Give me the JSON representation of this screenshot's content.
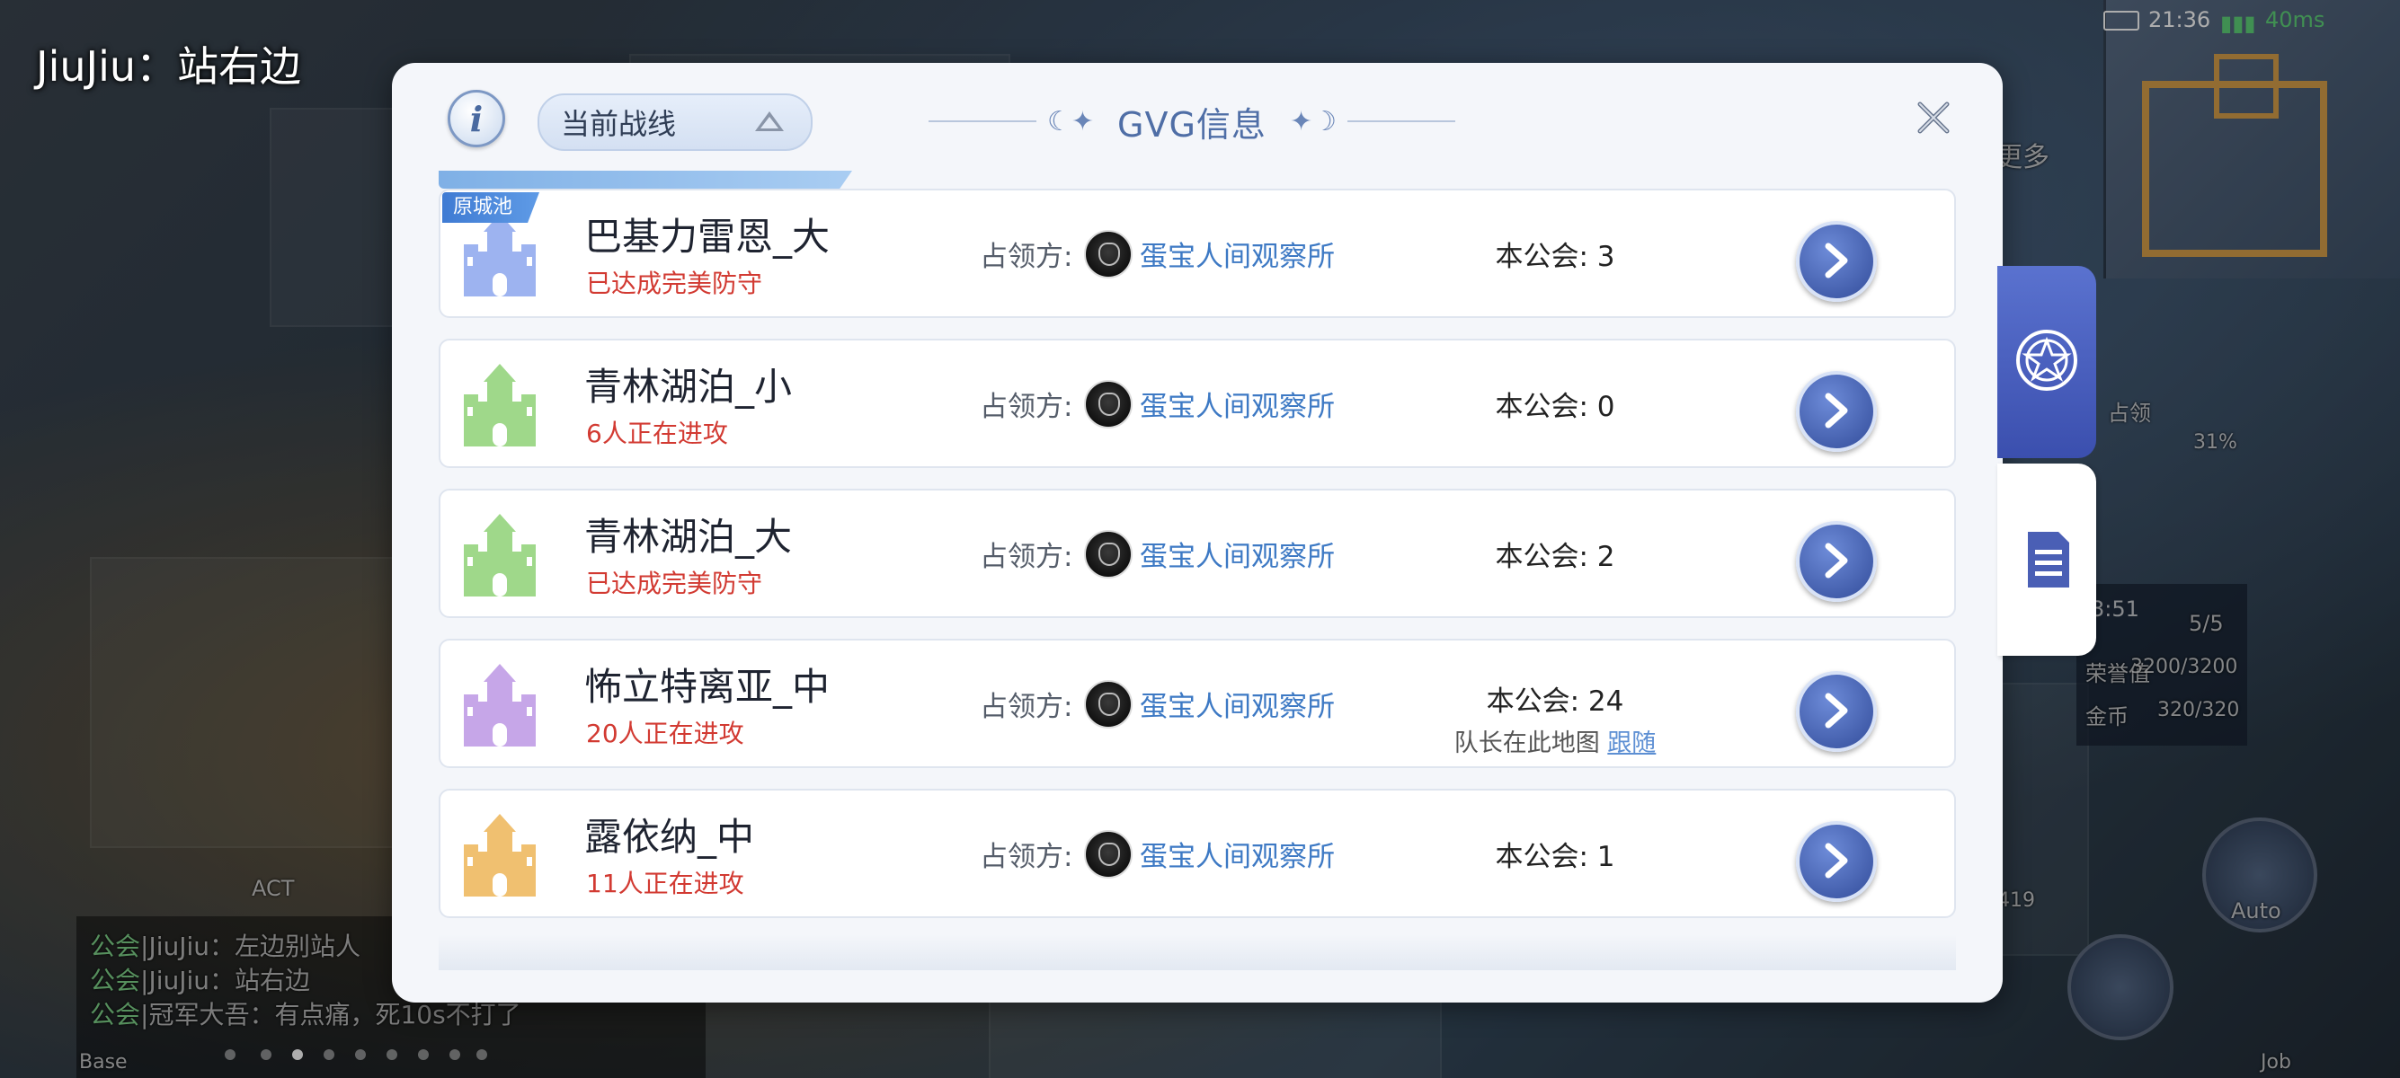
{
  "hud": {
    "player_name": "JiuJiu：站右边",
    "status_time": "21:36",
    "status_ping": "40ms",
    "minimap_more": "更多",
    "side_panel_countdown": "3:51",
    "side_panel_occupy": "占领",
    "side_panel_percent": "31%",
    "side_panel_stamina": "5/5",
    "side_panel_value_label": "荣誉值",
    "side_panel_value": "3200/3200",
    "side_panel_gold_label": "金币",
    "side_panel_gold": "320/320",
    "auto_label": "Auto",
    "job_label": "Job",
    "act_label": "ACT",
    "base_label": "Base",
    "item_count": "419"
  },
  "chat": [
    {
      "channel": "公会",
      "text": "|JiuJiu：左边别站人"
    },
    {
      "channel": "公会",
      "text": "|JiuJiu：站右边"
    },
    {
      "channel": "公会",
      "text": "|冠军大吾：有点痛，死10s不打了"
    }
  ],
  "modal": {
    "dropdown_label": "当前战线",
    "title": "GVG信息",
    "rows": [
      {
        "badge": "原城池",
        "name": "巴基力雷恩_大",
        "status": "已达成完美防守",
        "owner_label": "占领方:",
        "owner": "蛋宝人间观察所",
        "count": "本公会: 3",
        "castle_color": "#9db3f0"
      },
      {
        "badge": "",
        "name": "青林湖泊_小",
        "status": "6人正在进攻",
        "owner_label": "占领方:",
        "owner": "蛋宝人间观察所",
        "count": "本公会: 0",
        "castle_color": "#9fd88a"
      },
      {
        "badge": "",
        "name": "青林湖泊_大",
        "status": "已达成完美防守",
        "owner_label": "占领方:",
        "owner": "蛋宝人间观察所",
        "count": "本公会: 2",
        "castle_color": "#9fd88a"
      },
      {
        "badge": "",
        "name": "怖立特离亚_中",
        "status": "20人正在进攻",
        "owner_label": "占领方:",
        "owner": "蛋宝人间观察所",
        "count": "本公会: 24",
        "castle_color": "#c6a6e8",
        "leader_note": "队长在此地图",
        "follow": "跟随"
      },
      {
        "badge": "",
        "name": "露依纳_中",
        "status": "11人正在进攻",
        "owner_label": "占领方:",
        "owner": "蛋宝人间观察所",
        "count": "本公会: 1",
        "castle_color": "#f0c070"
      }
    ]
  },
  "icons": {
    "info": "info-icon",
    "close": "close-icon",
    "go": "chevron-right-icon",
    "tab1": "magic-circle-icon",
    "tab2": "document-icon"
  }
}
